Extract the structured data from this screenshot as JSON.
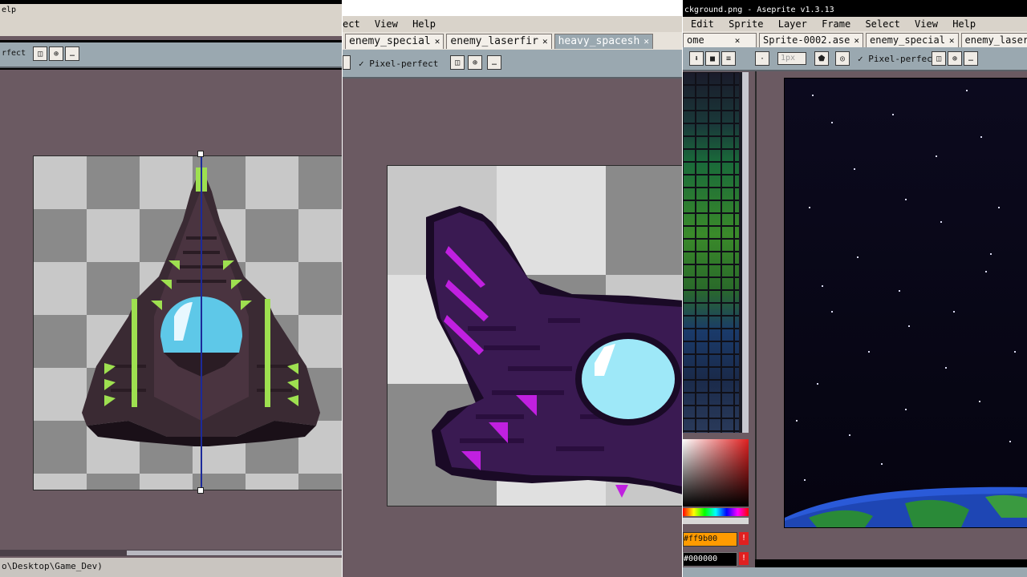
{
  "panel_left": {
    "menu_partial": "elp",
    "toolbar_label": "rfect",
    "status_path": "o\\Desktop\\Game_Dev)"
  },
  "panel_middle": {
    "menu": [
      "ect",
      "View",
      "Help"
    ],
    "tabs": [
      {
        "label": "enemy_special",
        "active": false
      },
      {
        "label": "enemy_laserfir",
        "active": false
      },
      {
        "label": "heavy_spacesh",
        "active": true
      }
    ],
    "pixel_perfect_label": "Pixel-perfect"
  },
  "panel_right": {
    "window_title": "ckground.png - Aseprite v1.3.13",
    "menu": [
      "Edit",
      "Sprite",
      "Layer",
      "Frame",
      "Select",
      "View",
      "Help"
    ],
    "tabs": [
      {
        "label": "ome",
        "active": false
      },
      {
        "label": "Sprite-0002.ase",
        "active": false
      },
      {
        "label": "enemy_special",
        "active": false
      },
      {
        "label": "enemy_laserfir",
        "active": false
      }
    ],
    "brush_size": "1px",
    "pixel_perfect_label": "Pixel-perfect",
    "fg_color": "#ff9b00",
    "bg_color": "#000000"
  },
  "icons": [
    "close-icon",
    "check-icon",
    "symmetry-icon",
    "more-icon",
    "warning-icon"
  ],
  "colors": {
    "workspace": "#6b5a62",
    "toolbar": "#9aa8b0",
    "ship_dark": "#3a2a33",
    "ship_green": "#9ee050",
    "ship_cockpit": "#5ec8e8",
    "enemy_purple": "#3a1a52",
    "enemy_magenta": "#c020e0",
    "space": "#0a0718",
    "planet_blue": "#2a5ad8",
    "planet_green": "#2a8a38"
  }
}
